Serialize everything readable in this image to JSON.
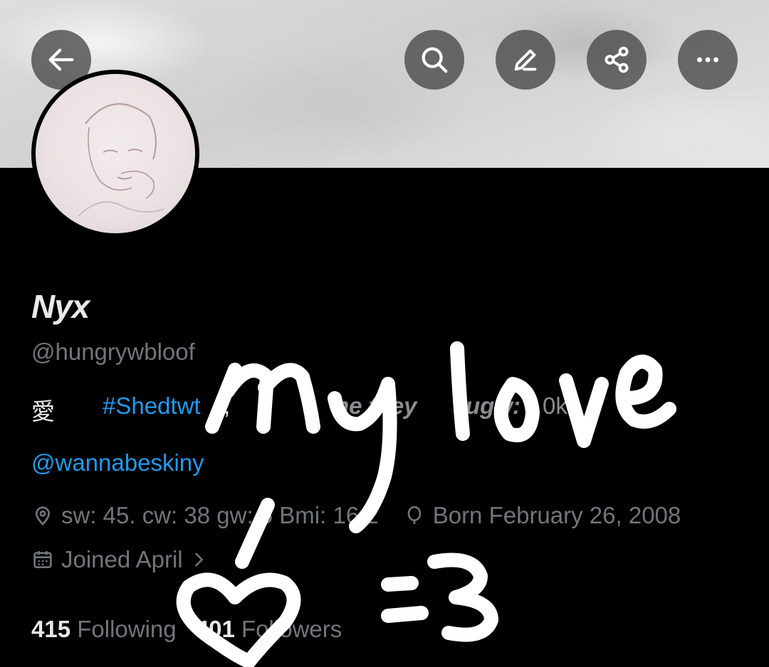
{
  "header": {
    "back_icon": "arrow-left-icon",
    "actions": [
      "search-icon",
      "edit-icon",
      "share-icon",
      "more-icon"
    ]
  },
  "profile": {
    "name": "Nyx",
    "handle": "@hungrywbloof",
    "bio": {
      "symbol": "愛",
      "hashtag": "#Shedtwt",
      "comma": ",",
      "pronouns_fragment": "he they",
      "ugw_fragment": "ugw:",
      "ugw_value_fragment": "0kg"
    },
    "mention": "@wannabeskiny",
    "location": "sw: 45. cw: 38 gw: 5 Bmi: 16,2",
    "birthday": "Born February 26, 2008",
    "joined": "Joined April",
    "following_count": "415",
    "following_label": "Following",
    "followers_count": "401",
    "followers_label": "Followers"
  },
  "overlay_handwriting": {
    "text": "my love / =3",
    "color": "#ffffff"
  },
  "colors": {
    "background": "#000000",
    "link": "#1d9bf0",
    "muted": "#71767b",
    "primary_text": "#e7e9ea"
  }
}
